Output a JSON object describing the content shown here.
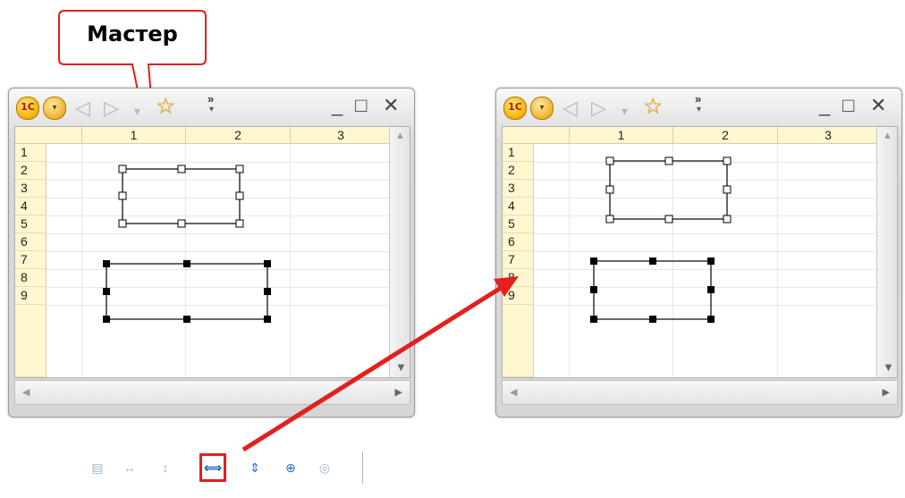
{
  "callout": {
    "label": "Мастер"
  },
  "window_left": {
    "title_controls": {
      "logo": "1C",
      "menu": "▾",
      "back": "◁",
      "forward": "▷",
      "history": "▾",
      "favorite": "☆",
      "more": "»",
      "minimize": "_",
      "maximize": "□",
      "close": "✕"
    },
    "columns": [
      "1",
      "2",
      "3"
    ],
    "rows": [
      "1",
      "2",
      "3",
      "4",
      "5",
      "6",
      "7",
      "8",
      "9"
    ]
  },
  "window_right": {
    "title_controls": {
      "logo": "1C",
      "menu": "▾",
      "back": "◁",
      "forward": "▷",
      "history": "▾",
      "favorite": "☆",
      "more": "»",
      "minimize": "_",
      "maximize": "□",
      "close": "✕"
    },
    "columns": [
      "1",
      "2",
      "3"
    ],
    "rows": [
      "1",
      "2",
      "3",
      "4",
      "5",
      "6",
      "7",
      "8",
      "9"
    ]
  },
  "toolbar": {
    "items": [
      {
        "name": "align-icon",
        "glyph": "▤"
      },
      {
        "name": "same-width-icon",
        "glyph": "↔"
      },
      {
        "name": "same-height-icon",
        "glyph": "↕"
      },
      {
        "name": "same-width-active-icon",
        "glyph": "⟺"
      },
      {
        "name": "center-vertical-icon",
        "glyph": "⇕"
      },
      {
        "name": "center-both-icon",
        "glyph": "⊕"
      },
      {
        "name": "bulb-icon",
        "glyph": "◎"
      }
    ]
  },
  "colors": {
    "accent_red": "#e31f1f",
    "header_bg": "#fff7d0"
  }
}
